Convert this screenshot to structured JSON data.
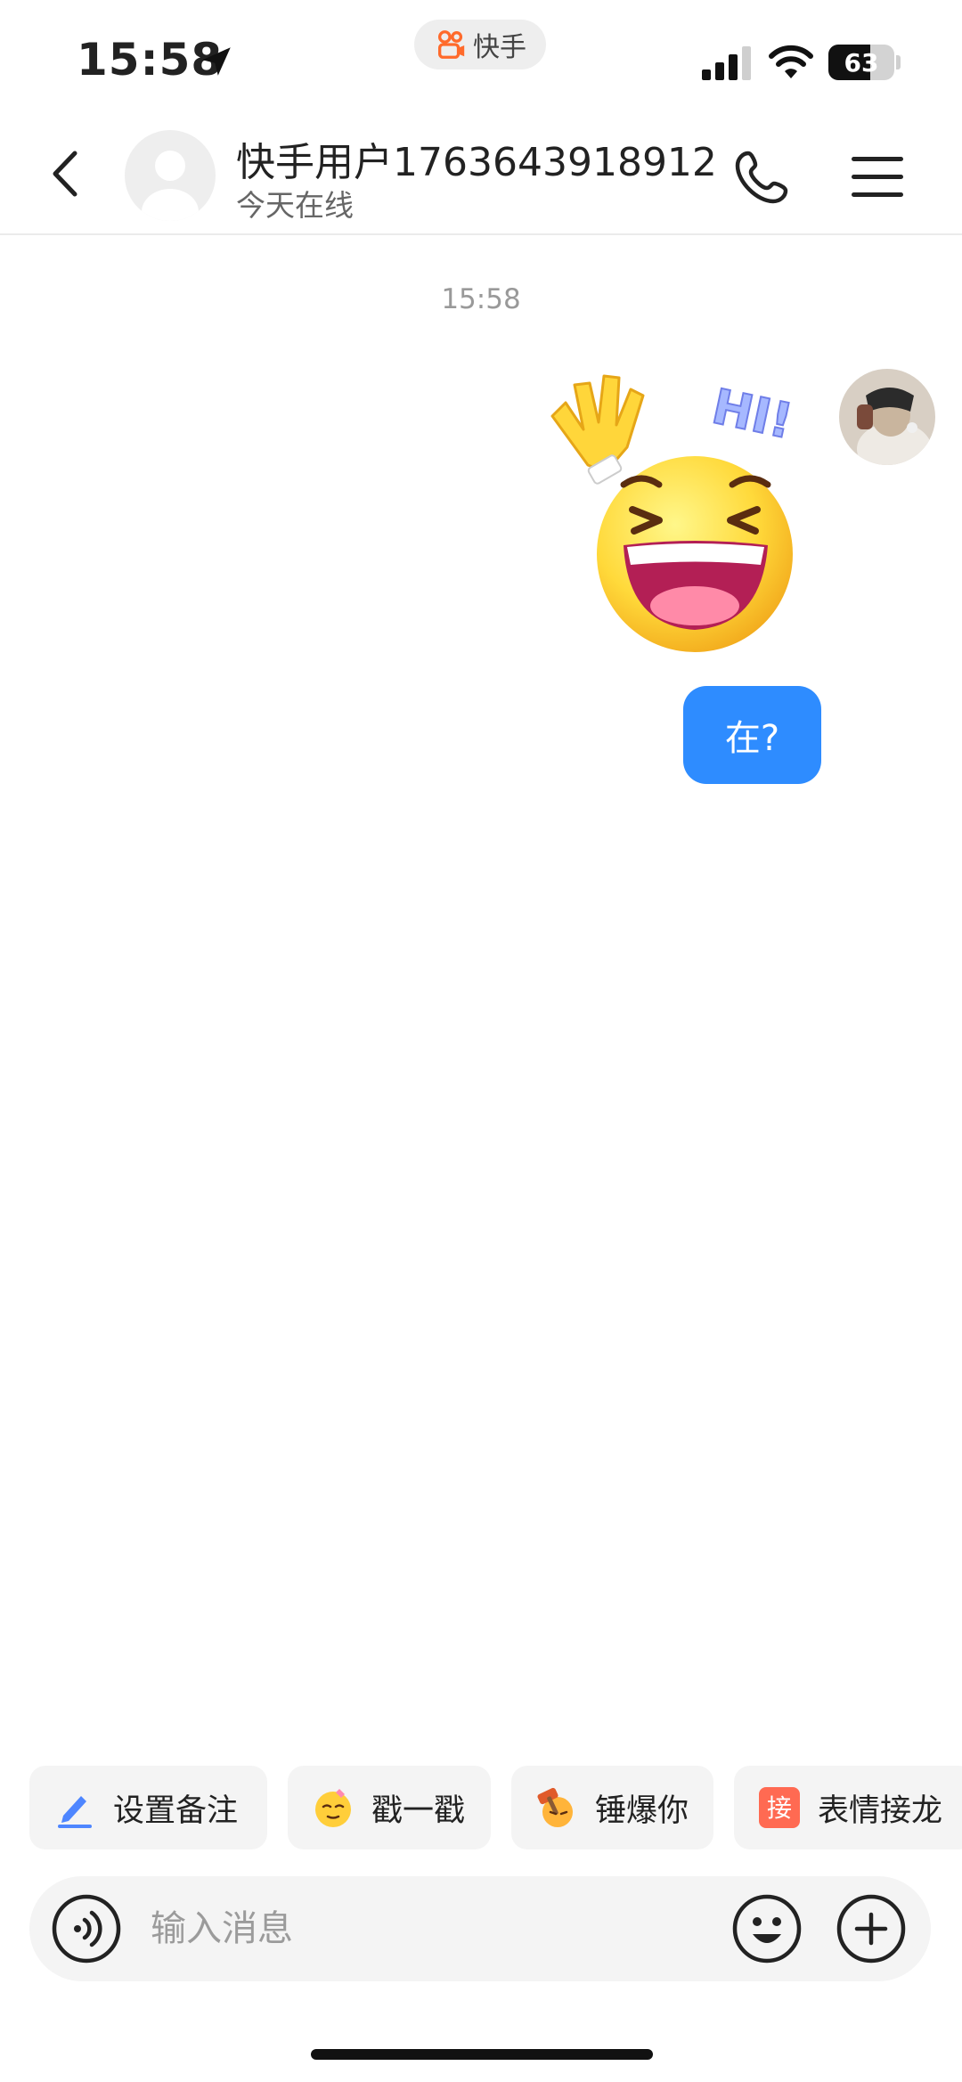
{
  "status_bar": {
    "time": "15:58",
    "app_name": "快手",
    "battery": "63",
    "battery_level": 0.63
  },
  "header": {
    "user_name": "快手用户1763643918912",
    "user_status": "今天在线"
  },
  "chat": {
    "timestamp": "15:58",
    "messages": [
      {
        "type": "sticker",
        "sticker_name": "hi-wave-laughing-sticker",
        "sticker_text": "HI!"
      },
      {
        "type": "text",
        "text": "在?"
      }
    ]
  },
  "quick_actions": [
    {
      "label": "设置备注",
      "icon": "pencil-icon"
    },
    {
      "label": "戳一戳",
      "icon": "poke-emoji-icon"
    },
    {
      "label": "锤爆你",
      "icon": "hammer-emoji-icon"
    },
    {
      "label": "表情接龙",
      "icon": "sticker-relay-icon",
      "icon_text": "接"
    }
  ],
  "input": {
    "placeholder": "输入消息"
  },
  "colors": {
    "bubble": "#2e8cff",
    "accent_orange": "#ff6a2b",
    "chip_bg": "#f4f4f4"
  }
}
